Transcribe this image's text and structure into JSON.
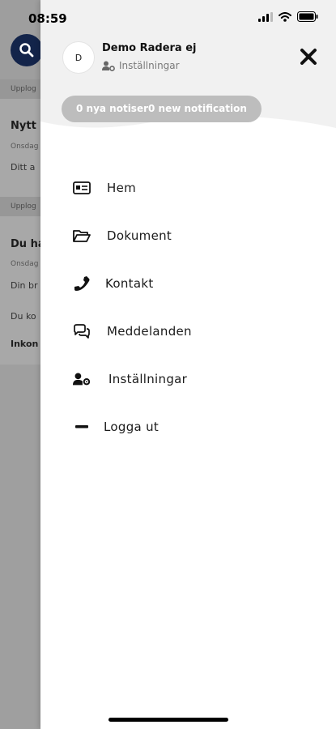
{
  "status_bar": {
    "time": "08:59"
  },
  "background": {
    "section_1": "Upplog",
    "card_1": {
      "title": "Nytt",
      "meta": "Onsdag",
      "text": "Ditt a"
    },
    "section_2": "Upplog",
    "card_2": {
      "title": "Du ha",
      "meta": "Onsdag",
      "text_1": "Din br",
      "text_2": "Du ko",
      "bold": "Inkon"
    }
  },
  "drawer": {
    "avatar_initial": "D",
    "user_name": "Demo Radera ej",
    "settings_label": "Inställningar",
    "notification_pill": "0 nya notiser0 new notification",
    "menu": [
      {
        "label": "Hem",
        "icon": "id-card-icon"
      },
      {
        "label": "Dokument",
        "icon": "folder-open-icon"
      },
      {
        "label": "Kontakt",
        "icon": "phone-icon"
      },
      {
        "label": "Meddelanden",
        "icon": "chat-bubbles-icon"
      },
      {
        "label": "Inställningar",
        "icon": "user-settings-icon"
      },
      {
        "label": "Logga ut",
        "icon": "minus-icon"
      }
    ]
  }
}
